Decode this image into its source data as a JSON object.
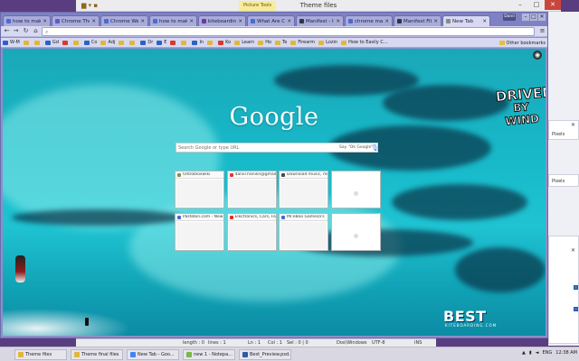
{
  "explorer": {
    "title": "Theme files",
    "context_tab": "Picture Tools",
    "controls": {
      "minimize": "–",
      "maximize": "□",
      "close": "✕"
    }
  },
  "chrome": {
    "tabs": [
      {
        "label": "how to make",
        "color": "#4a6bd0"
      },
      {
        "label": "Chrome Them",
        "color": "#5a5ccc"
      },
      {
        "label": "Chrome Web",
        "color": "#4a6bd0"
      },
      {
        "label": "how to make",
        "color": "#4a6bd0"
      },
      {
        "label": "kiteboarding",
        "color": "#6a3b9a"
      },
      {
        "label": "What Are Chr",
        "color": "#4a6bd0"
      },
      {
        "label": "Manifest - Ico",
        "color": "#333344"
      },
      {
        "label": "chrome manif",
        "color": "#4a6bd0"
      },
      {
        "label": "Manifest File",
        "color": "#333344"
      },
      {
        "label": "New Tab",
        "color": "#888888"
      }
    ],
    "user_badge": "Danil",
    "window_controls": {
      "minimize": "–",
      "maximize": "□",
      "close": "✕"
    },
    "nav": {
      "back": "←",
      "forward": "→",
      "reload": "↻",
      "home": "⌂"
    },
    "omnibox": {
      "value": ""
    },
    "bookmarks": [
      {
        "label": "W-M",
        "color": "#2b62c8"
      },
      {
        "label": "",
        "color": "#e0b73a"
      },
      {
        "label": "",
        "color": "#e0b73a"
      },
      {
        "label": "Gd",
        "color": "#2b62c8"
      },
      {
        "label": "",
        "color": "#d43a2f"
      },
      {
        "label": "",
        "color": "#e0b73a"
      },
      {
        "label": "Co",
        "color": "#2b62c8"
      },
      {
        "label": "Adj",
        "color": "#e0b73a"
      },
      {
        "label": "",
        "color": "#e0b73a"
      },
      {
        "label": "",
        "color": "#e0b73a"
      },
      {
        "label": "Dr",
        "color": "#2b62c8"
      },
      {
        "label": "E",
        "color": "#2b62c8"
      },
      {
        "label": "",
        "color": "#d43a2f"
      },
      {
        "label": "",
        "color": "#e0b73a"
      },
      {
        "label": "In",
        "color": "#2b62c8"
      },
      {
        "label": "",
        "color": "#e0b73a"
      },
      {
        "label": "Ko",
        "color": "#d43a2f"
      },
      {
        "label": "Learn",
        "color": "#e0b73a"
      },
      {
        "label": "Ho",
        "color": "#e0b73a"
      },
      {
        "label": "Te",
        "color": "#e0b73a"
      },
      {
        "label": "Firearm",
        "color": "#e0b73a"
      },
      {
        "label": "Lozin",
        "color": "#e0b73a"
      },
      {
        "label": "How to Easily C...",
        "color": "#e0b73a"
      }
    ],
    "other_bookmarks": "Other bookmarks"
  },
  "ntp": {
    "logo": "Google",
    "search_placeholder": "Search Google or type URL",
    "say_ok_google": "Say \"Ok Google\"",
    "tiles": [
      {
        "title": "Oldrobloxwiki",
        "color": "#7a9a4a"
      },
      {
        "title": "daniil.hanilin@gmail.c",
        "color": "#d93a2f"
      },
      {
        "title": "Download music, mov",
        "color": "#4a4a4a"
      },
      {
        "title": "",
        "color": "#dddddd"
      },
      {
        "title": "Pastebin.com - New Jo",
        "color": "#4a6bd0"
      },
      {
        "title": "Electronics, Cars, Fa",
        "color": "#e2312b"
      },
      {
        "title": "Mr.eBoo Gamesa's",
        "color": "#4a6bd0"
      },
      {
        "title": "",
        "color": "#dddddd"
      }
    ],
    "brand_top_line1": "DRIVEN",
    "brand_top_line2": "BY WIND",
    "brand_bottom": "BEST",
    "brand_sub": "KITEBOARDING.COM"
  },
  "notepad_status": {
    "length": "length : 0",
    "lines": "lines : 1",
    "ln": "Ln : 1",
    "col": "Col : 1",
    "sel": "Sel : 0 | 0",
    "eol": "Dos\\Windows",
    "encoding": "UTF-8",
    "mode": "INS"
  },
  "side_panel": {
    "pixels_1": "Pixels",
    "pixels_2": "Pixels"
  },
  "taskbar": {
    "tasks": [
      {
        "label": "Theme files",
        "color": "#e0b73a"
      },
      {
        "label": "Theme final files",
        "color": "#e0b73a"
      },
      {
        "label": "New Tab - Goo...",
        "color": "#4285f4"
      },
      {
        "label": "new 1 - Notepa...",
        "color": "#7ab648"
      },
      {
        "label": "Best_Preview.psd...",
        "color": "#2a5aa8"
      }
    ],
    "language": "ENG",
    "time": "12:38 AM"
  }
}
